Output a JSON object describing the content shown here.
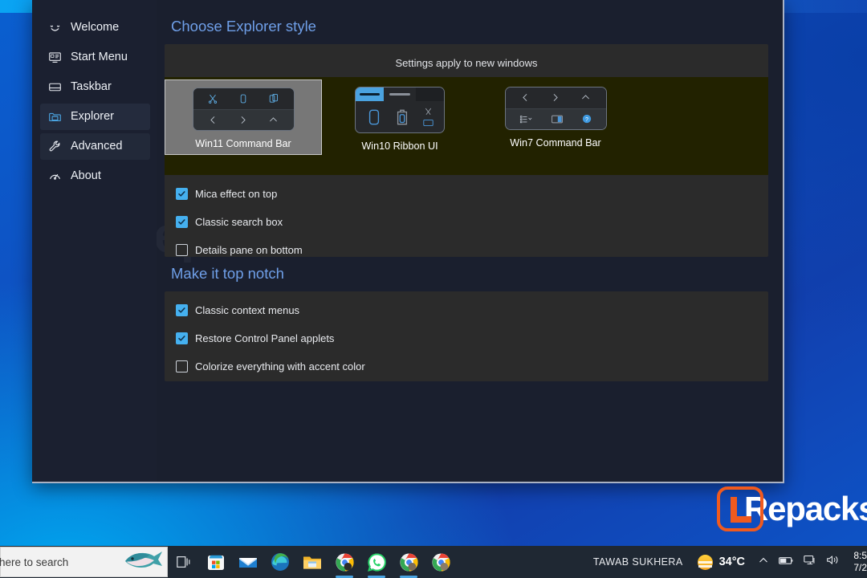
{
  "window": {
    "watermark": "lrepacks.com.ru"
  },
  "sidebar": {
    "items": [
      {
        "label": "Welcome",
        "icon": "smiley-icon",
        "state": "normal"
      },
      {
        "label": "Start Menu",
        "icon": "monitor-icon",
        "state": "normal"
      },
      {
        "label": "Taskbar",
        "icon": "taskbar-icon",
        "state": "normal"
      },
      {
        "label": "Explorer",
        "icon": "folder-icon",
        "state": "selected"
      },
      {
        "label": "Advanced",
        "icon": "wrench-icon",
        "state": "soft"
      },
      {
        "label": "About",
        "icon": "info-icon",
        "state": "normal"
      }
    ]
  },
  "explorer_section": {
    "title": "Choose Explorer style",
    "apply_note": "Settings apply to new windows",
    "styles": [
      {
        "label": "Win11 Command Bar",
        "selected": true
      },
      {
        "label": "Win10 Ribbon UI",
        "selected": false
      },
      {
        "label": "Win7 Command Bar",
        "selected": false
      }
    ],
    "options": [
      {
        "label": "Mica effect on top",
        "checked": true
      },
      {
        "label": "Classic search box",
        "checked": true
      },
      {
        "label": "Details pane on bottom",
        "checked": false
      }
    ]
  },
  "topnotch_section": {
    "title": "Make it top notch",
    "options": [
      {
        "label": "Classic context menus",
        "checked": true
      },
      {
        "label": "Restore Control Panel applets",
        "checked": true
      },
      {
        "label": "Colorize everything with accent color",
        "checked": false
      }
    ]
  },
  "logo": {
    "word": "Repacks"
  },
  "taskbar": {
    "search_text": "here to search",
    "user": "TAWAB SUKHERA",
    "temperature": "34°C",
    "clock_time": "8:5",
    "clock_date": "7/2",
    "apps": [
      {
        "name": "task-view-icon",
        "running": false
      },
      {
        "name": "microsoft-store-icon",
        "running": false
      },
      {
        "name": "mail-icon",
        "running": false
      },
      {
        "name": "edge-icon",
        "running": false
      },
      {
        "name": "file-explorer-icon",
        "running": false
      },
      {
        "name": "chrome-icon",
        "running": true
      },
      {
        "name": "whatsapp-icon",
        "running": true
      },
      {
        "name": "chrome-icon",
        "running": true
      },
      {
        "name": "chrome-icon",
        "running": false
      }
    ]
  },
  "colors": {
    "accent": "#45b0ef",
    "heading": "#6f9fe8",
    "card": "#2b2b2b",
    "tile_strip": "#222200",
    "logo_orange": "#f05a1e"
  }
}
